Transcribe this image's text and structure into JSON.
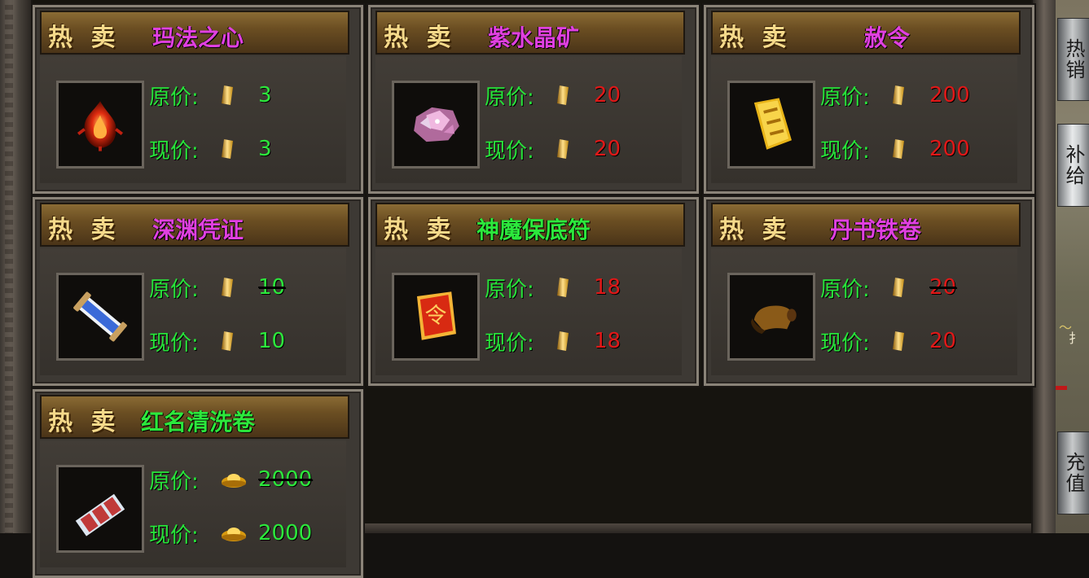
{
  "labels": {
    "hot": "热 卖",
    "orig": "原价:",
    "curr": "现价:"
  },
  "side_tabs": [
    {
      "label": "热销",
      "active": false
    },
    {
      "label": "补给",
      "active": true
    },
    {
      "label": "充值",
      "active": false
    }
  ],
  "items": [
    {
      "name": "玛法之心",
      "name_color": "#e040e0",
      "currency": "coin",
      "icon": "fire-heart-icon",
      "price_color": "#2ce83c",
      "orig": "3",
      "curr": "3"
    },
    {
      "name": "紫水晶矿",
      "name_color": "#e040e0",
      "currency": "coin",
      "icon": "amethyst-ore-icon",
      "price_color": "#e01818",
      "orig": "20",
      "curr": "20"
    },
    {
      "name": "赦令",
      "name_color": "#e040e0",
      "currency": "coin",
      "icon": "pardon-scroll-icon",
      "price_color": "#e01818",
      "orig": "200",
      "curr": "200"
    },
    {
      "name": "深渊凭证",
      "name_color": "#e040e0",
      "currency": "coin",
      "icon": "abyss-voucher-icon",
      "price_color": "#2ce83c",
      "orig": "10",
      "curr": "10"
    },
    {
      "name": "神魔保底符",
      "name_color": "#2ce83c",
      "currency": "coin",
      "icon": "talisman-icon",
      "price_color": "#e01818",
      "orig": "18",
      "curr": "18"
    },
    {
      "name": "丹书铁卷",
      "name_color": "#e040e0",
      "currency": "coin",
      "icon": "iron-scroll-icon",
      "price_color": "#e01818",
      "orig": "20",
      "curr": "20"
    },
    {
      "name": "红名清洗卷",
      "name_color": "#2ce83c",
      "currency": "ingot",
      "icon": "cleanse-scroll-icon",
      "price_color": "#2ce83c",
      "orig": "2000",
      "curr": "2000"
    }
  ]
}
